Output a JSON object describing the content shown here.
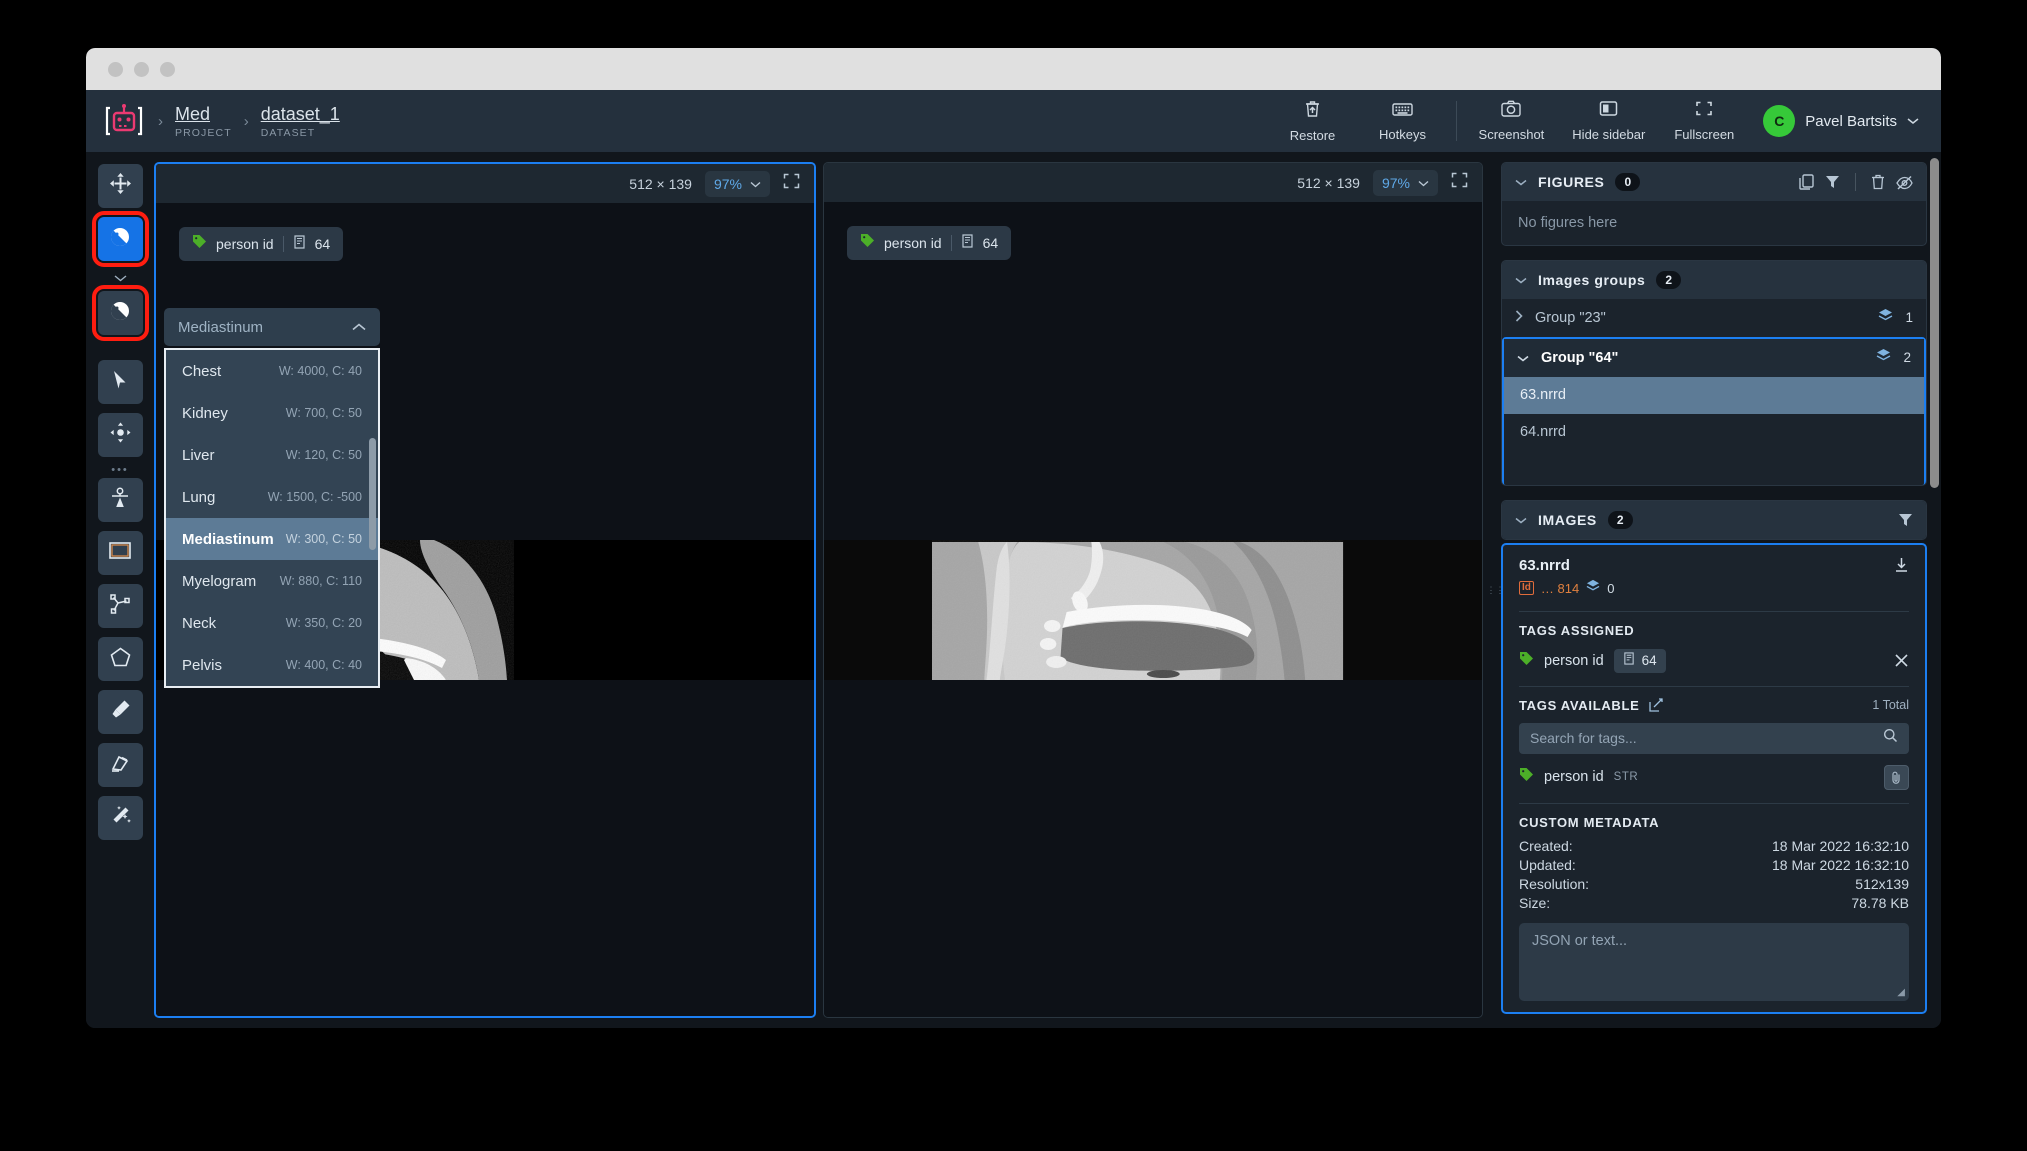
{
  "header": {
    "logo_icon": "robot-logo-icon",
    "breadcrumb": [
      {
        "label": "Med",
        "sublabel": "PROJECT"
      },
      {
        "label": "dataset_1",
        "sublabel": "DATASET"
      }
    ],
    "separator": "›",
    "actions": [
      {
        "label": "Restore",
        "icon": "restore-trash-icon"
      },
      {
        "label": "Hotkeys",
        "icon": "keyboard-icon"
      },
      {
        "label": "Screenshot",
        "icon": "camera-icon"
      },
      {
        "label": "Hide sidebar",
        "icon": "sidebar-icon"
      },
      {
        "label": "Fullscreen",
        "icon": "fullscreen-icon"
      }
    ],
    "user": {
      "initial": "C",
      "name": "Pavel Bartsits",
      "avatar_color": "#36c939"
    }
  },
  "toolbar": {
    "tools": [
      {
        "name": "pan-tool",
        "icon": "move-arrows-icon"
      },
      {
        "name": "window-level-tool",
        "icon": "contrast-circle-icon"
      },
      {
        "name": "window-level-preset-tool",
        "icon": "contrast-circle-icon"
      },
      {
        "name": "select-tool",
        "icon": "cursor-arrow-icon"
      },
      {
        "name": "drag-tool",
        "icon": "move-diamond-icon"
      },
      {
        "name": "anchor-point-tool",
        "icon": "keypoint-icon"
      },
      {
        "name": "bounding-box-tool",
        "icon": "rectangle-icon"
      },
      {
        "name": "polyline-tool",
        "icon": "polyline-icon"
      },
      {
        "name": "polygon-tool",
        "icon": "pentagon-icon"
      },
      {
        "name": "brush-tool",
        "icon": "brush-icon"
      },
      {
        "name": "eraser-tool",
        "icon": "eraser-icon"
      },
      {
        "name": "smart-tool",
        "icon": "magic-wand-icon"
      }
    ]
  },
  "preset_dropdown": {
    "selected": "Mediastinum",
    "chevron": "chevron-up-icon",
    "options": [
      {
        "name": "Chest",
        "window": "W: 4000, C: 40"
      },
      {
        "name": "Kidney",
        "window": "W: 700, C: 50"
      },
      {
        "name": "Liver",
        "window": "W: 120, C: 50"
      },
      {
        "name": "Lung",
        "window": "W: 1500, C: -500"
      },
      {
        "name": "Mediastinum",
        "window": "W: 300, C: 50"
      },
      {
        "name": "Myelogram",
        "window": "W: 880, C: 110"
      },
      {
        "name": "Neck",
        "window": "W: 350, C: 20"
      },
      {
        "name": "Pelvis",
        "window": "W: 400, C: 40"
      }
    ]
  },
  "viewports": [
    {
      "dimensions": "512 × 139",
      "zoom": "97%",
      "tag": {
        "name": "person id",
        "value": "64"
      },
      "selected": true
    },
    {
      "dimensions": "512 × 139",
      "zoom": "97%",
      "tag": {
        "name": "person id",
        "value": "64"
      },
      "selected": false
    }
  ],
  "sidebar": {
    "figures": {
      "title": "FIGURES",
      "count": "0",
      "empty_text": "No figures here",
      "icons": [
        "copy-icon",
        "filter-icon",
        "trash-icon",
        "eye-off-icon"
      ]
    },
    "images_groups": {
      "title": "Images groups",
      "count": "2",
      "groups": [
        {
          "label": "Group \"23\"",
          "count": "1",
          "expanded": false,
          "selected": false,
          "files": []
        },
        {
          "label": "Group \"64\"",
          "count": "2",
          "expanded": true,
          "selected": true,
          "files": [
            {
              "name": "63.nrrd",
              "selected": true
            },
            {
              "name": "64.nrrd",
              "selected": false
            }
          ]
        }
      ]
    },
    "images": {
      "title": "IMAGES",
      "count": "2",
      "filter_icon": "filter-icon",
      "card": {
        "name": "63.nrrd",
        "id_label": "Id",
        "id_value": "… 814",
        "layers_count": "0",
        "download_icon": "download-icon",
        "tags_assigned_title": "TAGS ASSIGNED",
        "assigned": [
          {
            "name": "person id",
            "value": "64",
            "remove_icon": "close-icon"
          }
        ],
        "tags_available_title": "TAGS AVAILABLE",
        "tags_available_edit_icon": "edit-icon",
        "tags_total": "1 Total",
        "search_placeholder": "Search for tags...",
        "search_icon": "search-icon",
        "available": [
          {
            "name": "person id",
            "type": "STR",
            "attach_icon": "paperclip-icon"
          }
        ],
        "custom_metadata_title": "CUSTOM METADATA",
        "metadata": [
          {
            "key": "Created:",
            "value": "18 Mar 2022 16:32:10"
          },
          {
            "key": "Updated:",
            "value": "18 Mar 2022 16:32:10"
          },
          {
            "key": "Resolution:",
            "value": "512x139"
          },
          {
            "key": "Size:",
            "value": "78.78 KB"
          }
        ],
        "json_placeholder": "JSON or text..."
      }
    }
  },
  "colors": {
    "accent_blue": "#1c7ff2",
    "highlight_red": "#ff1d10",
    "tag_green": "#4caf28",
    "id_orange": "#e0803f",
    "avatar_green": "#36c939",
    "zoom_text": "#5fa9e8"
  }
}
